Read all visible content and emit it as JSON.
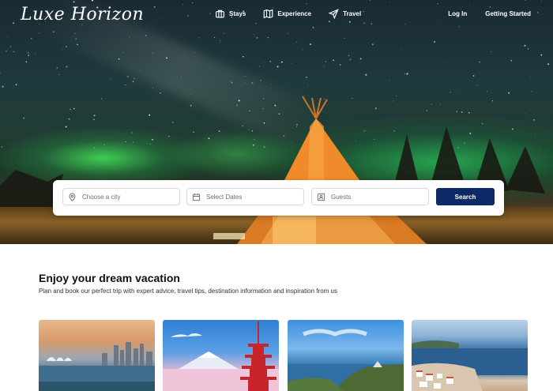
{
  "brand": {
    "logo": "Luxe Horizon"
  },
  "nav": {
    "items": [
      {
        "label": "Stays",
        "icon": "briefcase-icon"
      },
      {
        "label": "Experience",
        "icon": "map-icon"
      },
      {
        "label": "Travel",
        "icon": "send-icon"
      }
    ],
    "login": "Log In",
    "get_started": "Getting Started"
  },
  "search": {
    "city_placeholder": "Choose a city",
    "dates_placeholder": "Select Dates",
    "guests_placeholder": "Guests",
    "button": "Search"
  },
  "section": {
    "title": "Enjoy your dream vacation",
    "subtitle": "Plan and book our perfect trip with expert advice, travel tips, destination information and  inspiration from us"
  },
  "colors": {
    "accent": "#0b2a66",
    "text": "#111111"
  }
}
